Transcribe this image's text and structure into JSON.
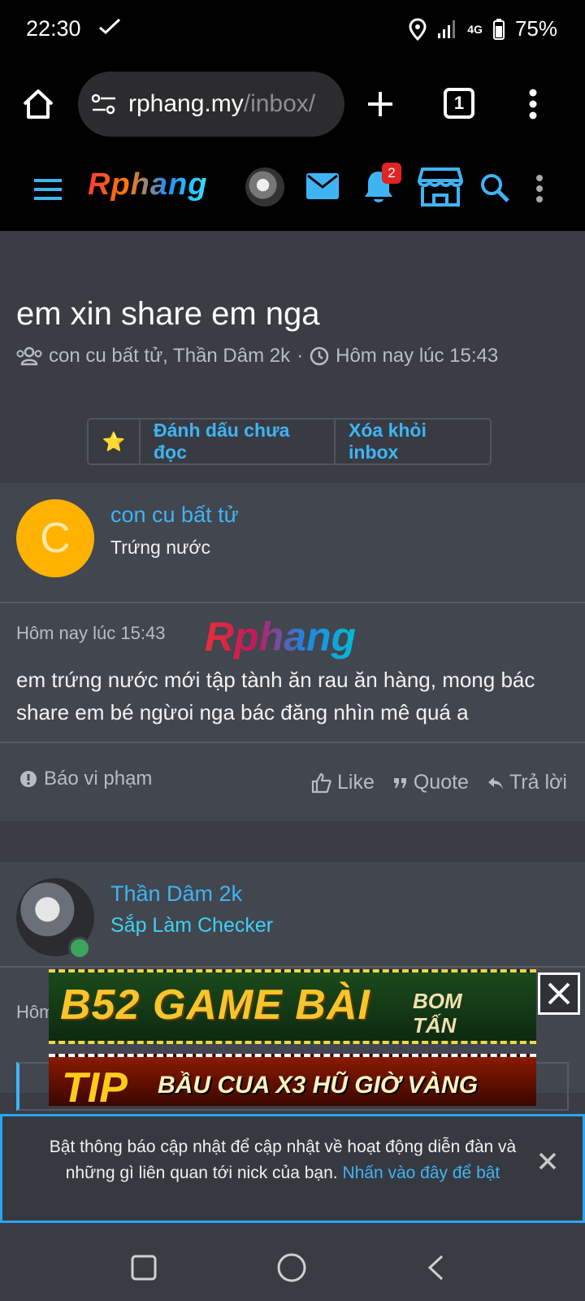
{
  "status": {
    "time": "22:30",
    "network": "4G",
    "battery": "75%"
  },
  "browser": {
    "url_host": "rphang.my",
    "url_path": "/inbox/",
    "tab_count": "1"
  },
  "header": {
    "logo": "Rphang",
    "notification_count": "2"
  },
  "thread": {
    "title": "em xin share em nga",
    "participants": "con cu bất tử, Thần Dâm 2k",
    "separator": "·",
    "time": "Hôm nay lúc 15:43",
    "actions": {
      "star": "⭐",
      "mark_unread": "Đánh dấu chưa đọc",
      "remove_inbox": "Xóa khỏi inbox"
    }
  },
  "post1": {
    "avatar_letter": "C",
    "username": "con cu bất tử",
    "user_title": "Trứng nước",
    "date": "Hôm nay lúc 15:43",
    "watermark": "Rphang",
    "body": "em trứng nước mới tập tành ăn rau ăn hàng, mong bác share em bé ngừoi nga bác đăng nhìn mê quá a",
    "report": "Báo vi phạm",
    "like": "Like",
    "quote": "Quote",
    "reply": "Trả lời"
  },
  "post2": {
    "username": "Thần Dâm 2k",
    "user_title": "Sắp Làm Checker",
    "date_partial": "Hôm"
  },
  "ads": {
    "banner1_main": "B52 GAME BÀI",
    "banner1_side": "BOM TẤN",
    "banner2_main": "TIP",
    "banner2_text": "BẦU CUA X3 HŨ GIỜ VÀNG"
  },
  "notice": {
    "text": "Bật thông báo cập nhật để cập nhật về hoạt động diễn đàn và những gì liên quan tới nick của bạn.",
    "link": "Nhấn vào đây để bật"
  },
  "colors": {
    "accent": "#3fb4f5",
    "background": "#3a3d44",
    "post_bg": "#42464e",
    "badge": "#e02424"
  }
}
